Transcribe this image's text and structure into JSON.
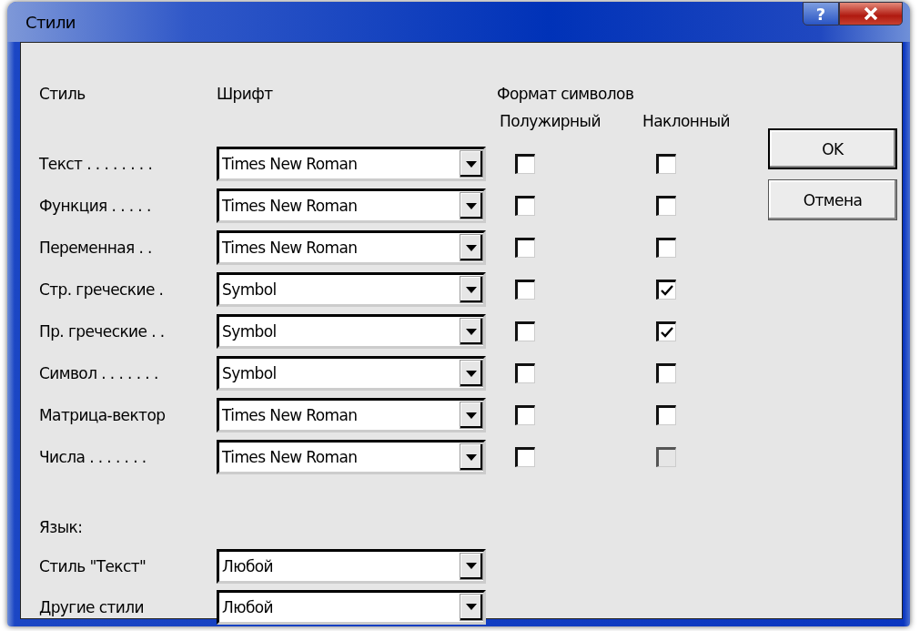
{
  "window": {
    "title": "Стили",
    "help_button": "?"
  },
  "headers": {
    "style": "Стиль",
    "font": "Шрифт",
    "format": "Формат символов",
    "bold": "Полужирный",
    "italic": "Наклонный"
  },
  "styles": [
    {
      "label": "Текст . . . . . . . .",
      "font": "Times New Roman",
      "bold": {
        "checked": false,
        "disabled": false
      },
      "italic": {
        "checked": false,
        "disabled": false
      }
    },
    {
      "label": "Функция  . . . . .",
      "font": "Times New Roman",
      "bold": {
        "checked": false,
        "disabled": false
      },
      "italic": {
        "checked": false,
        "disabled": false
      }
    },
    {
      "label": "Переменная . .",
      "font": "Times New Roman",
      "bold": {
        "checked": false,
        "disabled": false
      },
      "italic": {
        "checked": false,
        "disabled": false
      }
    },
    {
      "label": "Стр. греческие .",
      "font": "Symbol",
      "bold": {
        "checked": false,
        "disabled": false
      },
      "italic": {
        "checked": true,
        "disabled": false
      }
    },
    {
      "label": "Пр. греческие . .",
      "font": "Symbol",
      "bold": {
        "checked": false,
        "disabled": false
      },
      "italic": {
        "checked": true,
        "disabled": false
      }
    },
    {
      "label": "Символ . . . . . . .",
      "font": "Symbol",
      "bold": {
        "checked": false,
        "disabled": false
      },
      "italic": {
        "checked": false,
        "disabled": false
      }
    },
    {
      "label": "Матрица-вектор",
      "font": "Times New Roman",
      "bold": {
        "checked": false,
        "disabled": false
      },
      "italic": {
        "checked": false,
        "disabled": false
      }
    },
    {
      "label": "Числа . . . . . . .",
      "font": "Times New Roman",
      "bold": {
        "checked": false,
        "disabled": false
      },
      "italic": {
        "checked": false,
        "disabled": true
      }
    }
  ],
  "language": {
    "heading": "Язык:",
    "rows": [
      {
        "label": "Стиль \"Текст\"",
        "value": "Любой"
      },
      {
        "label": "Другие стили",
        "value": "Любой"
      }
    ]
  },
  "buttons": [
    {
      "label": "OK",
      "default": true
    },
    {
      "label": "Отмена",
      "default": false
    }
  ]
}
